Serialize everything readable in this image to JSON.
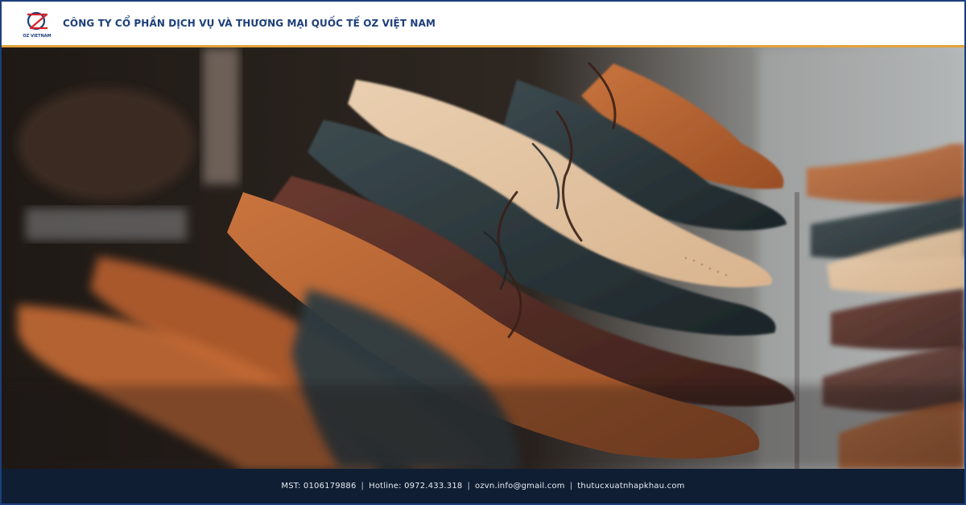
{
  "header": {
    "logo_text": "OZ VIETNAM",
    "company_name": "CÔNG TY CỔ PHẦN DỊCH VỤ VÀ THƯƠNG MẠI QUỐC TẾ OZ VIỆT NAM"
  },
  "hero": {
    "icon": "shoes-photo"
  },
  "footer": {
    "mst": "MST: 0106179886",
    "hotline": "Hotline: 0972.433.318",
    "email": "ozvn.info@gmail.com",
    "website": "thutucxuatnhapkhau.com",
    "separator": "|"
  },
  "colors": {
    "brand_blue": "#1d3f7a",
    "accent_gold": "#e2a33a",
    "footer_bg": "#0f1e33",
    "logo_red": "#d2232a"
  }
}
